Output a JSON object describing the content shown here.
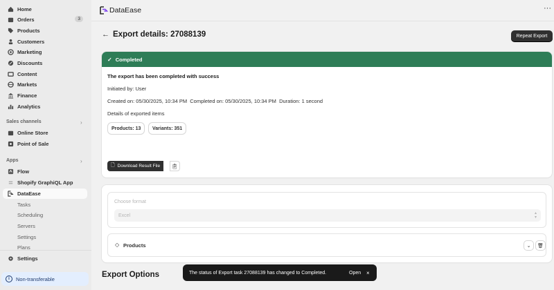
{
  "sidebar": {
    "items": [
      {
        "label": "Home",
        "icon": "home-icon"
      },
      {
        "label": "Orders",
        "icon": "orders-icon",
        "badge": "3"
      },
      {
        "label": "Products",
        "icon": "tag-icon"
      },
      {
        "label": "Customers",
        "icon": "person-icon"
      },
      {
        "label": "Marketing",
        "icon": "target-icon"
      },
      {
        "label": "Discounts",
        "icon": "discount-icon"
      },
      {
        "label": "Content",
        "icon": "content-icon"
      },
      {
        "label": "Markets",
        "icon": "globe-icon"
      },
      {
        "label": "Finance",
        "icon": "bank-icon"
      },
      {
        "label": "Analytics",
        "icon": "chart-icon"
      }
    ],
    "sales_channels_label": "Sales channels",
    "sales_channels": [
      {
        "label": "Online Store",
        "icon": "store-icon"
      },
      {
        "label": "Point of Sale",
        "icon": "pos-icon"
      }
    ],
    "apps_label": "Apps",
    "apps": [
      {
        "label": "Flow",
        "icon": "flow-icon"
      },
      {
        "label": "Shopify GraphiQL App",
        "icon": "graphiql-icon"
      },
      {
        "label": "DataEase",
        "icon": "dataease-icon"
      }
    ],
    "dataease_sub": [
      "Tasks",
      "Scheduling",
      "Servers",
      "Settings",
      "Plans"
    ],
    "settings_label": "Settings",
    "non_transferable_label": "Non-transferable"
  },
  "header": {
    "app_name": "DataEase",
    "more": "···"
  },
  "page": {
    "back": "←",
    "title": "Export details: 27088139",
    "repeat_button": "Repeat Export"
  },
  "status_card": {
    "banner": "Completed",
    "heading": "The export has been completed with success",
    "initiated": "Initiated by: User",
    "times": "Created on: 05/30/2025, 10:34 PM  Completed on: 05/30/2025, 10:34 PM  Duration: 1 second",
    "details_label": "Details of exported items",
    "products_pill": "Products: 13",
    "variants_pill": "Variants: 351",
    "download_button": "Download Result File"
  },
  "options_card": {
    "format_label": "Choose format",
    "format_value": "Excel",
    "products_label": "Products"
  },
  "export_options_heading": "Export Options",
  "toast": {
    "message": "The status of Export task 27088139 has changed to Completed.",
    "open": "Open",
    "close": "×"
  },
  "colors": {
    "banner_green": "#2e7d57",
    "primary_button": "#303030",
    "toast_bg": "#1a1a1a",
    "non_transferable_bg": "#e3eefe"
  }
}
